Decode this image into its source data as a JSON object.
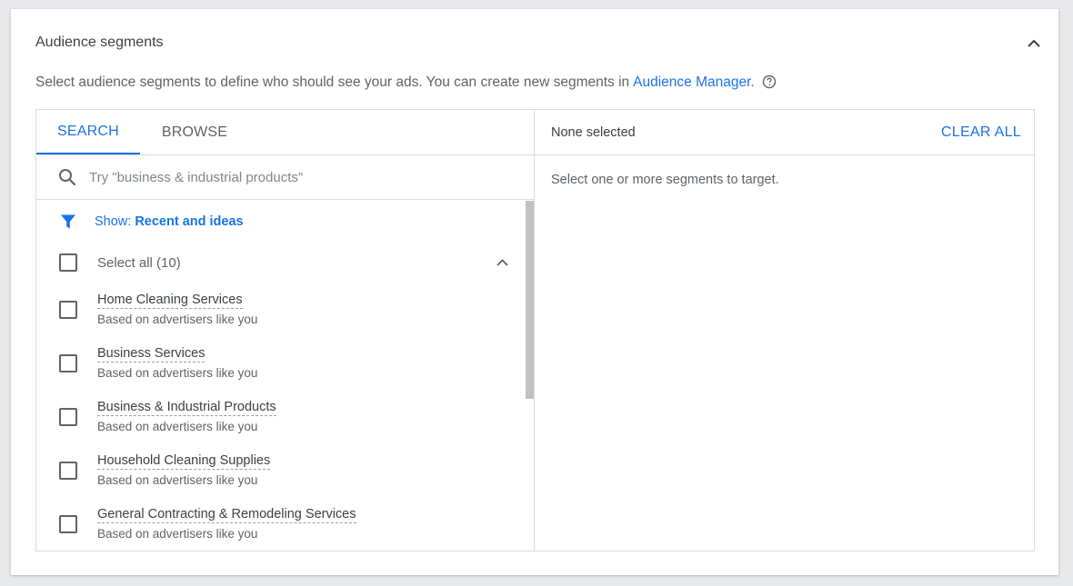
{
  "card": {
    "title": "Audience segments",
    "description_prefix": "Select audience segments to define who should see your ads. You can create new segments in",
    "description_link": "Audience Manager."
  },
  "tabs": [
    {
      "label": "SEARCH",
      "active": true
    },
    {
      "label": "BROWSE",
      "active": false
    }
  ],
  "search": {
    "placeholder": "Try \"business & industrial products\"",
    "value": ""
  },
  "filter": {
    "show_label": "Show:",
    "value": "Recent and ideas"
  },
  "select_all": {
    "label": "Select all (10)"
  },
  "items": [
    {
      "name": "Home Cleaning Services",
      "sub": "Based on advertisers like you"
    },
    {
      "name": "Business Services",
      "sub": "Based on advertisers like you"
    },
    {
      "name": "Business & Industrial Products",
      "sub": "Based on advertisers like you"
    },
    {
      "name": "Household Cleaning Supplies",
      "sub": "Based on advertisers like you"
    },
    {
      "name": "General Contracting & Remodeling Services",
      "sub": "Based on advertisers like you"
    }
  ],
  "selection": {
    "status": "None selected",
    "clear_label": "CLEAR ALL",
    "empty_message": "Select one or more segments to target."
  },
  "colors": {
    "accent": "#1a73e8",
    "text": "#3c4043",
    "muted": "#5f6368",
    "border": "#dadce0"
  },
  "icons": {
    "collapse": "chevron-up-icon",
    "help": "help-circle-icon",
    "search": "search-icon",
    "filter": "filter-icon"
  }
}
